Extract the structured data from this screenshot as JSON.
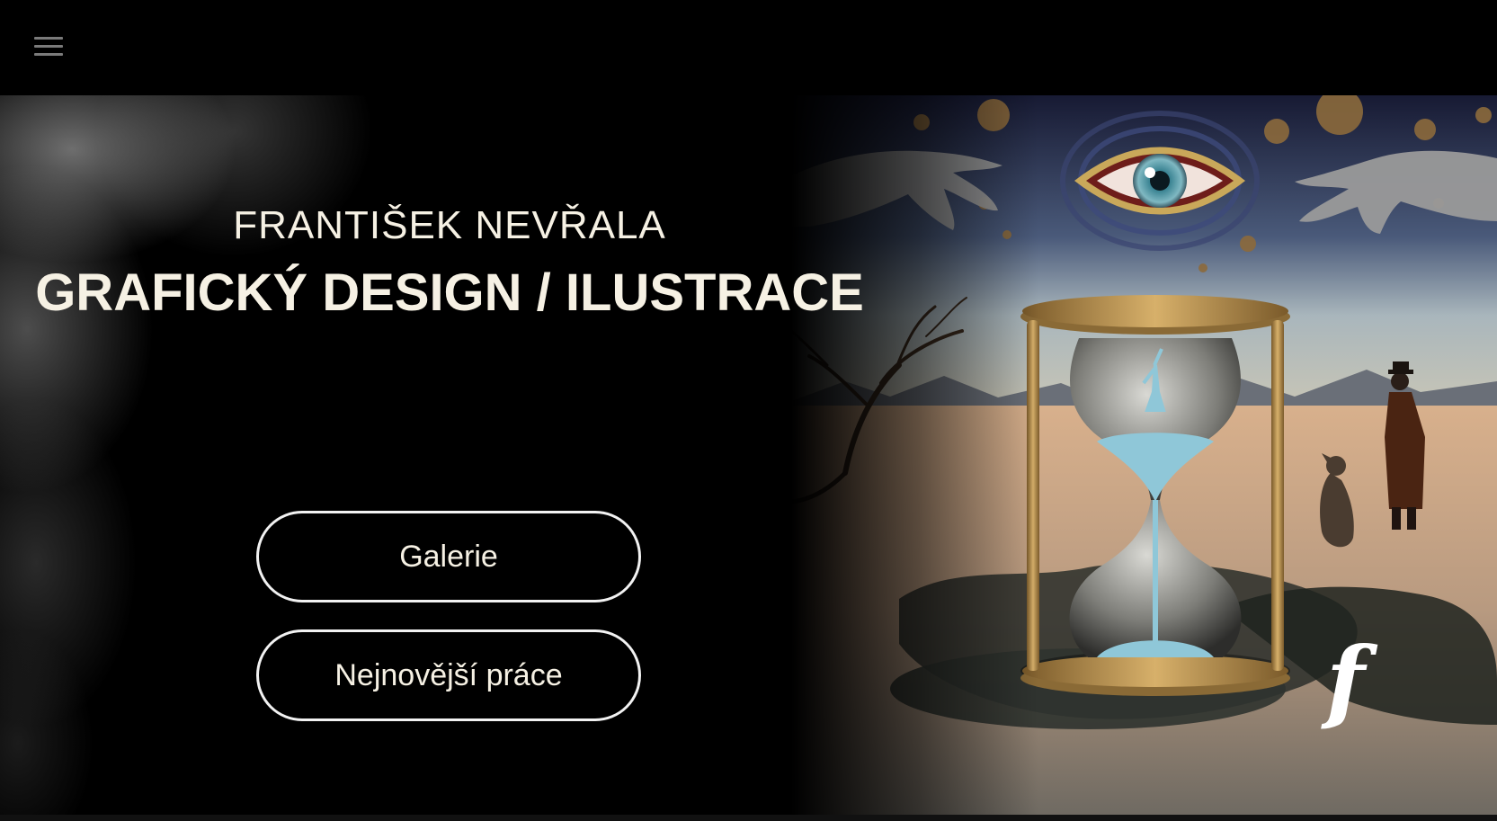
{
  "header": {
    "menu_icon": "hamburger-menu-icon"
  },
  "hero": {
    "name": "FRANTIŠEK NEVŘALA",
    "tagline": "GRAFICKÝ DESIGN / ILUSTRACE",
    "buttons": {
      "gallery": "Galerie",
      "latest": "Nejnovější práce"
    },
    "artwork_signature": "f"
  },
  "colors": {
    "background": "#000000",
    "title_text": "#f6f1e4",
    "button_border": "#f2f2f2",
    "menu_icon": "#7a7a7a"
  }
}
